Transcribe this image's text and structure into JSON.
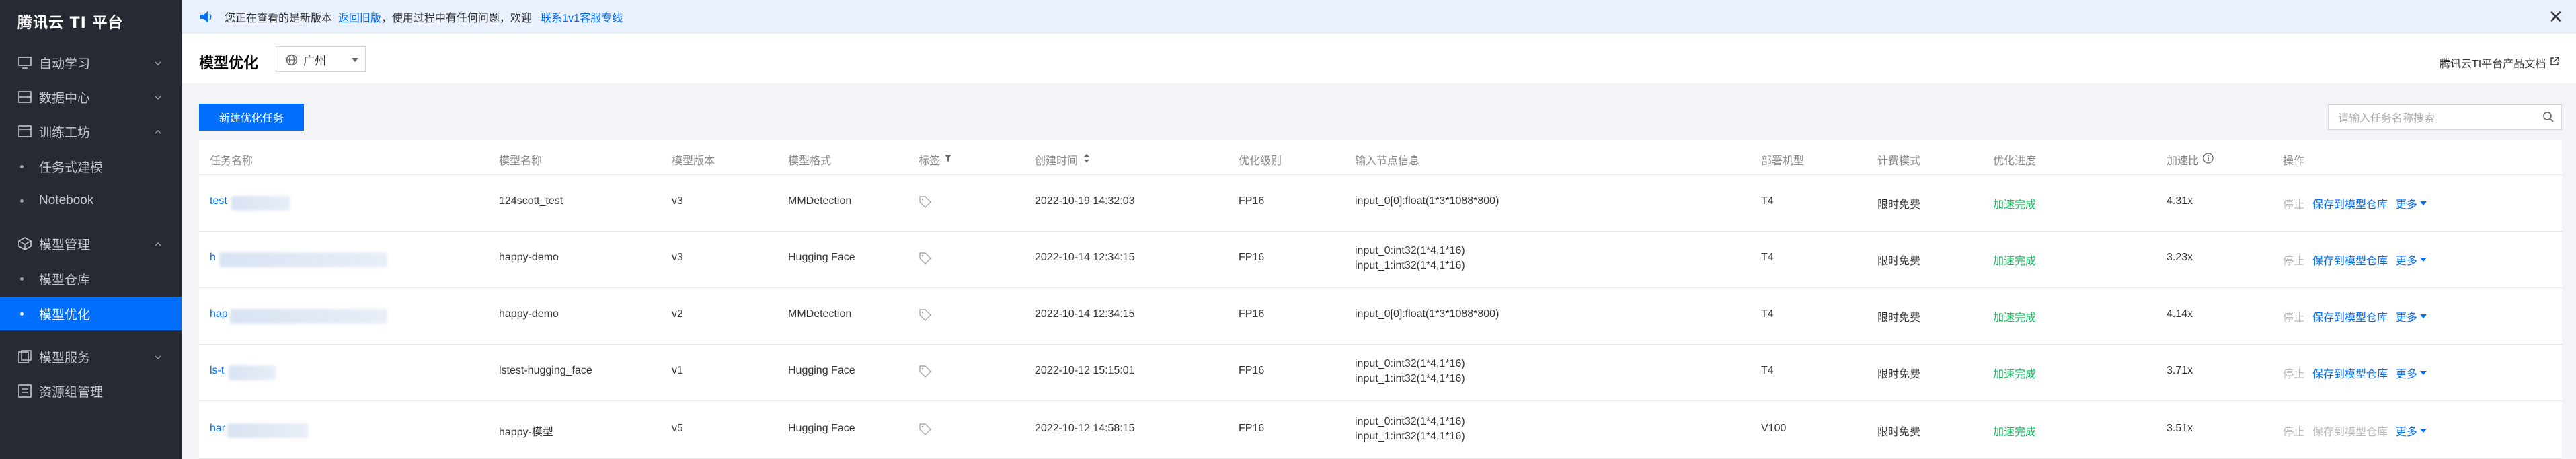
{
  "sidebar": {
    "brand": "腾讯云 TI 平台",
    "items": [
      {
        "label": "自动学习",
        "chevron": "⌄"
      },
      {
        "label": "数据中心",
        "chevron": "⌄"
      },
      {
        "label": "训练工坊",
        "chevron": "⌃"
      },
      {
        "label": "任务式建模"
      },
      {
        "label": "Notebook"
      },
      {
        "label": "模型管理",
        "chevron": "⌃"
      },
      {
        "label": "模型仓库"
      },
      {
        "label": "模型优化"
      },
      {
        "label": "模型服务",
        "chevron": "⌄"
      },
      {
        "label": "资源组管理"
      }
    ]
  },
  "notice": {
    "text1": "您正在查看的是新版本",
    "link1": "返回旧版",
    "text2": "，使用过程中有任何问题，欢迎",
    "link2": "联系1v1客服专线",
    "close": "✕"
  },
  "header": {
    "title": "模型优化",
    "region": "广州",
    "doc_link": "腾讯云TI平台产品文档"
  },
  "toolbar": {
    "new_button": "新建优化任务",
    "search_placeholder": "请输入任务名称搜索"
  },
  "table": {
    "columns": [
      "任务名称",
      "模型名称",
      "模型版本",
      "模型格式",
      "标签",
      "创建时间",
      "优化级别",
      "输入节点信息",
      "部署机型",
      "计费模式",
      "优化进度",
      "加速比",
      "操作"
    ],
    "rows": [
      {
        "name": "test",
        "model": "124scott_test",
        "version": "v3",
        "format": "MMDetection",
        "created": "2022-10-19 14:32:03",
        "level": "FP16",
        "input1": "input_0[0]:float(1*3*1088*800)",
        "input2": "",
        "machine": "T4",
        "billing": "限时免费",
        "progress": "加速完成",
        "speedup": "4.31x",
        "save_disabled": false
      },
      {
        "name": "h",
        "model": "happy-demo",
        "version": "v3",
        "format": "Hugging Face",
        "created": "2022-10-14 12:34:15",
        "level": "FP16",
        "input1": "input_0:int32(1*4,1*16)",
        "input2": "input_1:int32(1*4,1*16)",
        "machine": "T4",
        "billing": "限时免费",
        "progress": "加速完成",
        "speedup": "3.23x",
        "save_disabled": false
      },
      {
        "name": "hap",
        "model": "happy-demo",
        "version": "v2",
        "format": "MMDetection",
        "created": "2022-10-14 12:34:15",
        "level": "FP16",
        "input1": "input_0[0]:float(1*3*1088*800)",
        "input2": "",
        "machine": "T4",
        "billing": "限时免费",
        "progress": "加速完成",
        "speedup": "4.14x",
        "save_disabled": false
      },
      {
        "name": "ls-t",
        "model": "lstest-hugging_face",
        "version": "v1",
        "format": "Hugging Face",
        "created": "2022-10-12 15:15:01",
        "level": "FP16",
        "input1": "input_0:int32(1*4,1*16)",
        "input2": "input_1:int32(1*4,1*16)",
        "machine": "T4",
        "billing": "限时免费",
        "progress": "加速完成",
        "speedup": "3.71x",
        "save_disabled": false
      },
      {
        "name": "har",
        "model": "happy-模型",
        "version": "v5",
        "format": "Hugging Face",
        "created": "2022-10-12 14:58:15",
        "level": "FP16",
        "input1": "input_0:int32(1*4,1*16)",
        "input2": "input_1:int32(1*4,1*16)",
        "machine": "V100",
        "billing": "限时免费",
        "progress": "加速完成",
        "speedup": "3.51x",
        "save_disabled": true
      }
    ],
    "op_stop": "停止",
    "op_save": "保存到模型仓库",
    "op_more": "更多"
  },
  "colors": {
    "accent": "#006eff",
    "success": "#0abf5b",
    "sidebar_bg": "#262a33"
  }
}
